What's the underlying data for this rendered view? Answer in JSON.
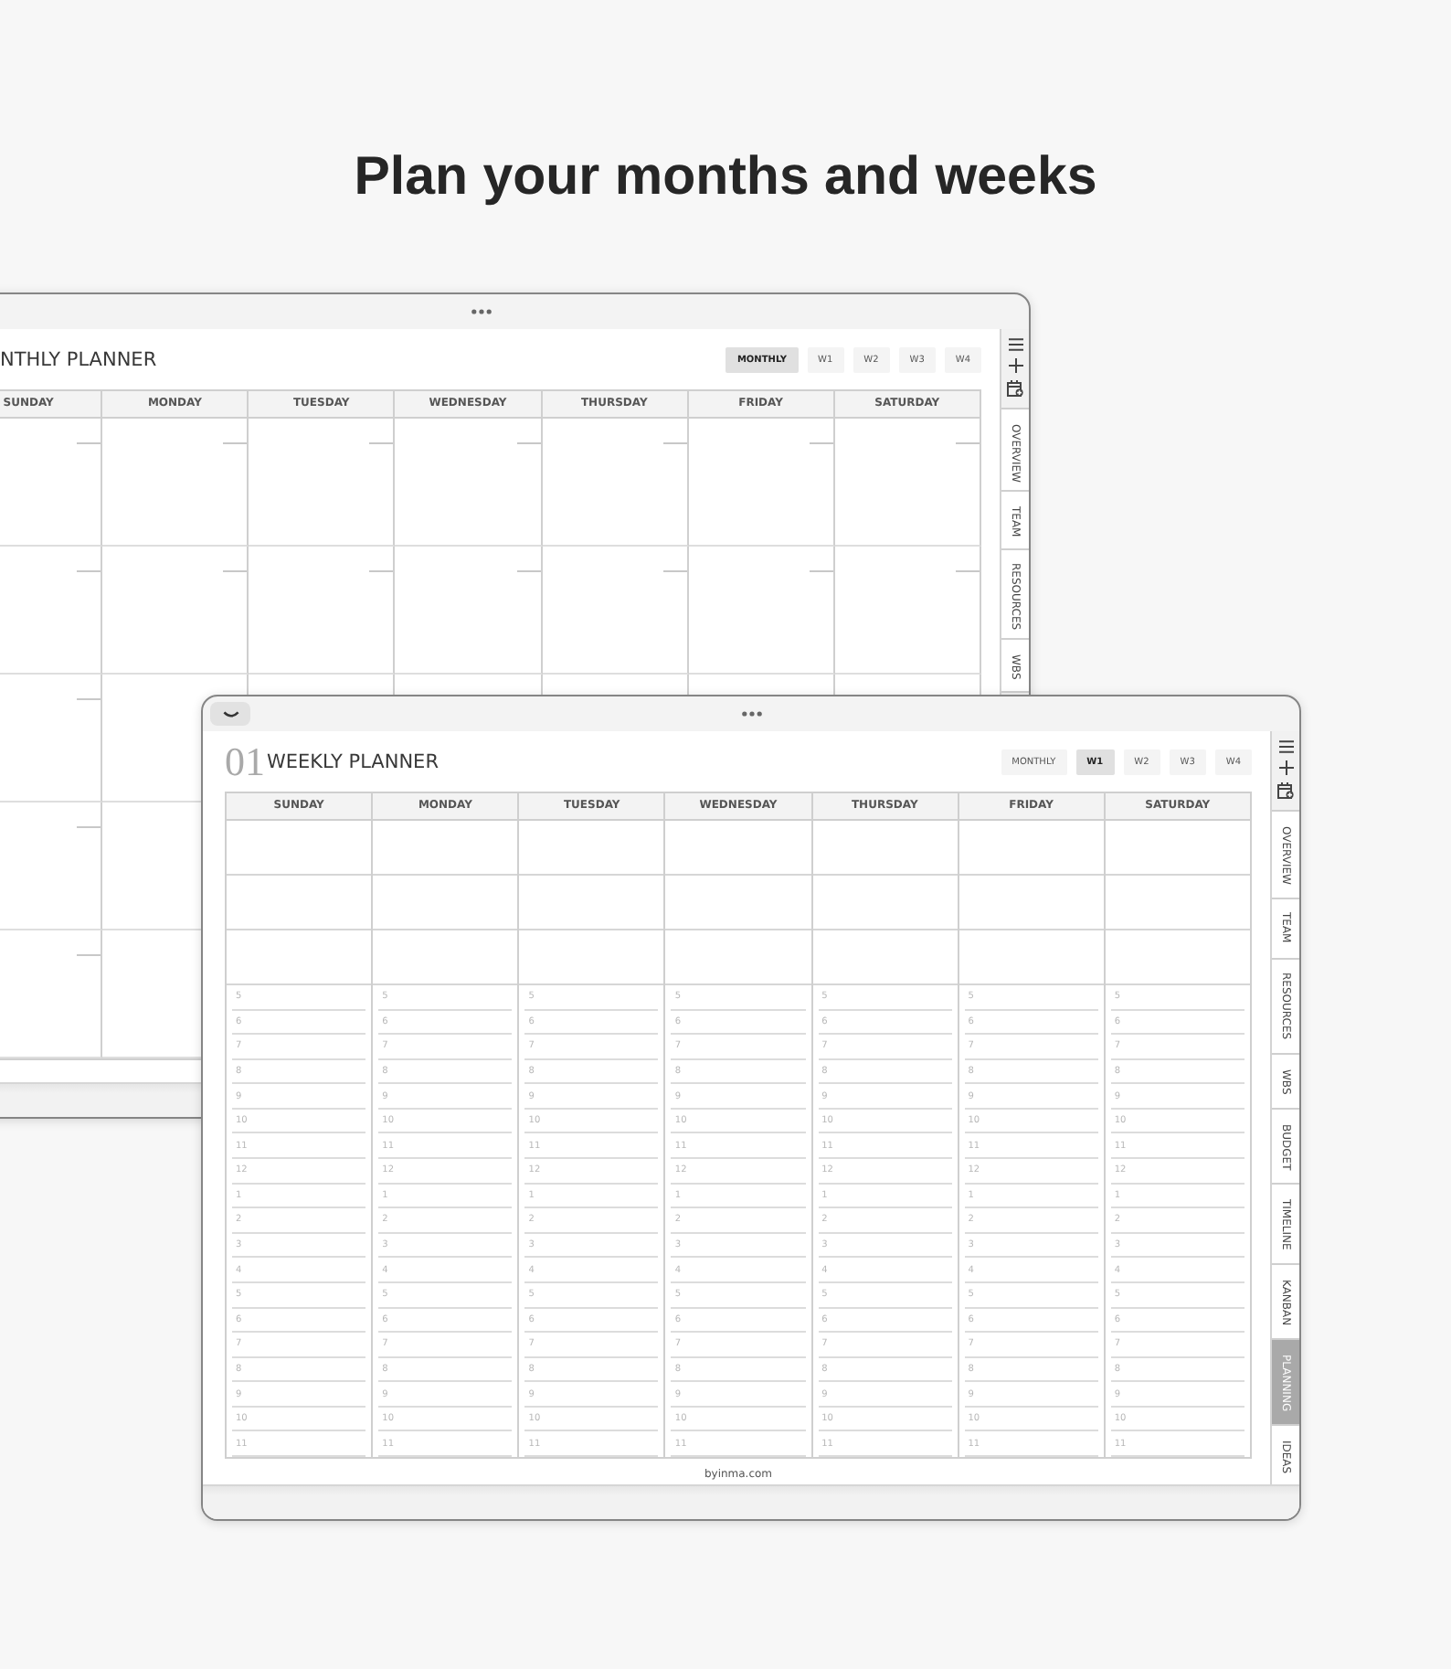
{
  "heading": "Plan your months and weeks",
  "monthly_tablet": {
    "title": "NTHLY PLANNER",
    "view_tabs": [
      {
        "label": "MONTHLY",
        "selected": true
      },
      {
        "label": "W1",
        "selected": false
      },
      {
        "label": "W2",
        "selected": false
      },
      {
        "label": "W3",
        "selected": false
      },
      {
        "label": "W4",
        "selected": false
      }
    ],
    "days": [
      "SUNDAY",
      "MONDAY",
      "TUESDAY",
      "WEDNESDAY",
      "THURSDAY",
      "FRIDAY",
      "SATURDAY"
    ],
    "sidebar_tabs": [
      {
        "label": "OVERVIEW",
        "selected": false
      },
      {
        "label": "TEAM",
        "selected": false
      },
      {
        "label": "RESOURCES",
        "selected": false
      },
      {
        "label": "WBS",
        "selected": false
      }
    ]
  },
  "weekly_tablet": {
    "page_number": "01",
    "title": "WEEKLY PLANNER",
    "view_tabs": [
      {
        "label": "MONTHLY",
        "selected": false
      },
      {
        "label": "W1",
        "selected": true
      },
      {
        "label": "W2",
        "selected": false
      },
      {
        "label": "W3",
        "selected": false
      },
      {
        "label": "W4",
        "selected": false
      }
    ],
    "days": [
      {
        "name": "SUNDAY",
        "hours": [
          "5",
          "6",
          "7",
          "8",
          "9",
          "10",
          "11",
          "12",
          "1",
          "2",
          "3",
          "4",
          "5",
          "6",
          "7",
          "8",
          "9",
          "10",
          "11"
        ]
      },
      {
        "name": "MONDAY",
        "hours": [
          "5",
          "6",
          "7",
          "8",
          "9",
          "10",
          "11",
          "12",
          "1",
          "2",
          "3",
          "4",
          "5",
          "6",
          "7",
          "8",
          "9",
          "10",
          "11"
        ]
      },
      {
        "name": "TUESDAY",
        "hours": [
          "5",
          "6",
          "7",
          "8",
          "9",
          "10",
          "11",
          "12",
          "1",
          "2",
          "3",
          "4",
          "5",
          "6",
          "7",
          "8",
          "9",
          "10",
          "11"
        ]
      },
      {
        "name": "WEDNESDAY",
        "hours": [
          "5",
          "6",
          "7",
          "8",
          "9",
          "10",
          "11",
          "12",
          "1",
          "2",
          "3",
          "4",
          "5",
          "6",
          "7",
          "8",
          "9",
          "10",
          "11"
        ]
      },
      {
        "name": "THURSDAY",
        "hours": [
          "5",
          "6",
          "7",
          "8",
          "9",
          "10",
          "11",
          "12",
          "1",
          "2",
          "3",
          "4",
          "5",
          "6",
          "7",
          "8",
          "9",
          "10",
          "11"
        ]
      },
      {
        "name": "FRIDAY",
        "hours": [
          "5",
          "6",
          "7",
          "8",
          "9",
          "10",
          "11",
          "12",
          "1",
          "2",
          "3",
          "4",
          "5",
          "6",
          "7",
          "8",
          "9",
          "10",
          "11"
        ]
      },
      {
        "name": "SATURDAY",
        "hours": [
          "5",
          "6",
          "7",
          "8",
          "9",
          "10",
          "11",
          "12",
          "1",
          "2",
          "3",
          "4",
          "5",
          "6",
          "7",
          "8",
          "9",
          "10",
          "11"
        ]
      }
    ],
    "sidebar_tabs": [
      {
        "label": "OVERVIEW",
        "selected": false
      },
      {
        "label": "TEAM",
        "selected": false
      },
      {
        "label": "RESOURCES",
        "selected": false
      },
      {
        "label": "WBS",
        "selected": false
      },
      {
        "label": "BUDGET",
        "selected": false
      },
      {
        "label": "TIMELINE",
        "selected": false
      },
      {
        "label": "KANBAN",
        "selected": false
      },
      {
        "label": "PLANNING",
        "selected": true
      },
      {
        "label": "IDEAS",
        "selected": false
      }
    ],
    "footer": "byinma.com"
  }
}
